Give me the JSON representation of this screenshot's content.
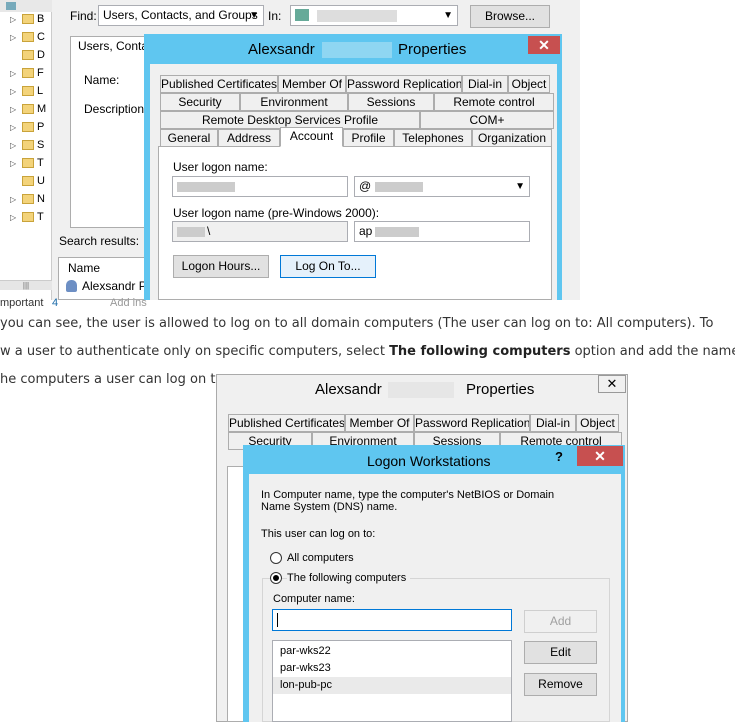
{
  "find_window": {
    "find_label": "Find:",
    "find_value": "Users, Contacts, and Groups",
    "in_label": "In:",
    "browse_label": "Browse...",
    "tab_label": "Users, Contac",
    "name_label": "Name:",
    "description_label": "Description:",
    "search_results_label": "Search results:",
    "col_name": "Name",
    "result_name": "Alexsandr P",
    "tree_letters": [
      "B",
      "C",
      "D",
      "F",
      "L",
      "M",
      "P",
      "S",
      "T",
      "U",
      "N",
      "T"
    ],
    "status_text": "mportant",
    "status_number": "4",
    "status_extra": "Add ins"
  },
  "properties_top": {
    "title_left": "Alexsandr",
    "title_right": "Properties",
    "tabs_row1": [
      "Published Certificates",
      "Member Of",
      "Password Replication",
      "Dial-in",
      "Object"
    ],
    "tabs_row2": [
      "Security",
      "Environment",
      "Sessions",
      "Remote control"
    ],
    "tabs_row3": [
      "Remote Desktop Services Profile",
      "COM+"
    ],
    "tabs_row4": [
      "General",
      "Address",
      "Account",
      "Profile",
      "Telephones",
      "Organization"
    ],
    "logon_name_label": "User logon name:",
    "domain_value": "@",
    "pre2000_label": "User logon name (pre-Windows 2000):",
    "pre2000_domain": "\\",
    "pre2000_user": "ap",
    "logon_hours_btn": "Logon Hours...",
    "log_on_to_btn": "Log On To..."
  },
  "article": {
    "line1": "you can see, the user is allowed to log on to all domain computers (The user can log on to: All computers). To",
    "line2_a": "w a user to authenticate only on specific computers, select ",
    "line2_bold": "The following computers",
    "line2_b": " option and add the names",
    "line3": "he computers a user can log on to;"
  },
  "properties_bottom": {
    "title_left": "Alexsandr",
    "title_right": "Properties",
    "tabs_row1": [
      "Published Certificates",
      "Member Of",
      "Password Replication",
      "Dial-in",
      "Object"
    ],
    "tabs_row2": [
      "Security",
      "Environment",
      "Sessions",
      "Remote control"
    ]
  },
  "logon_workstations": {
    "title": "Logon Workstations",
    "help_label": "?",
    "description": "In Computer name, type the computer's NetBIOS or Domain Name System (DNS) name.",
    "can_log_on_label": "This user can log on to:",
    "all_computers_label": "All computers",
    "following_computers_label": "The following computers",
    "computer_name_label": "Computer name:",
    "add_btn": "Add",
    "edit_btn": "Edit",
    "remove_btn": "Remove",
    "computers": [
      "par-wks22",
      "par-wks23",
      "lon-pub-pc"
    ]
  }
}
